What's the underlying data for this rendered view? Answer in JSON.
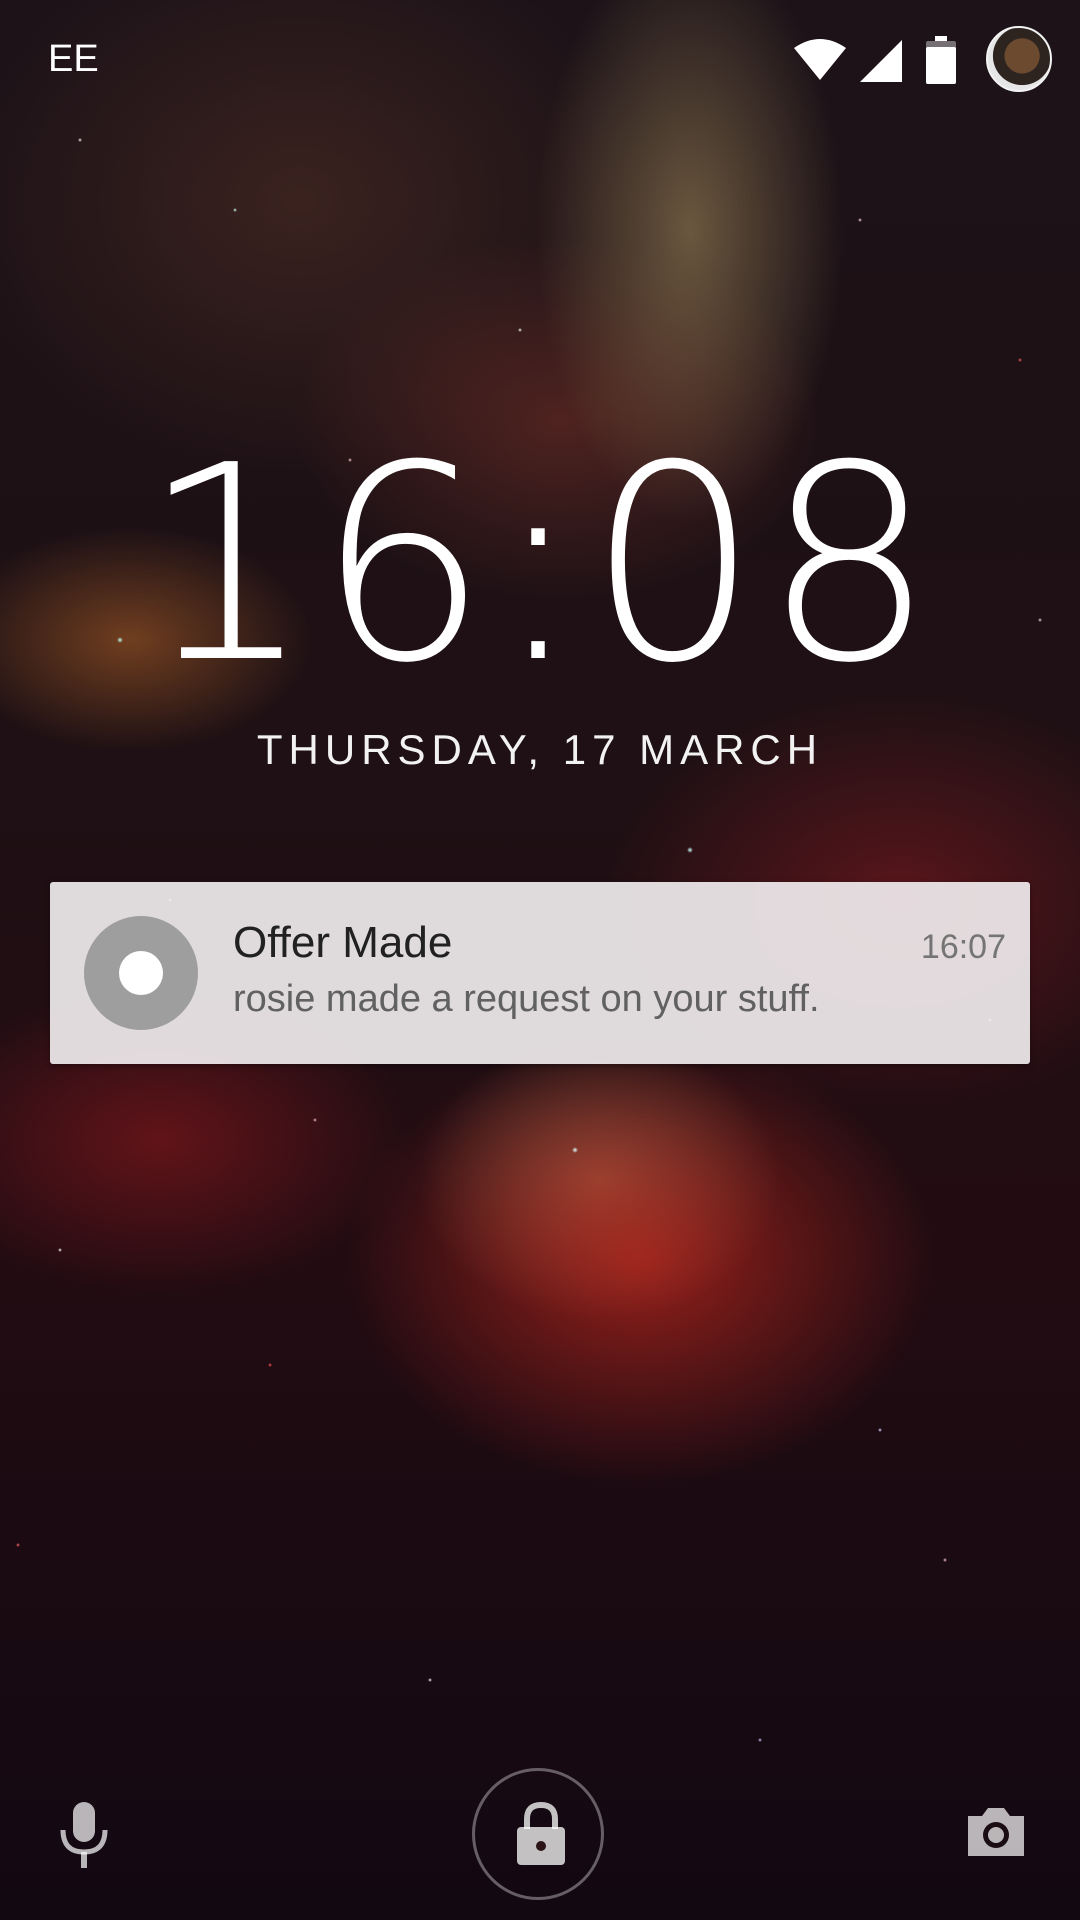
{
  "status_bar": {
    "carrier": "EE",
    "icons": [
      "wifi-icon",
      "signal-icon",
      "battery-icon",
      "avatar"
    ]
  },
  "lockscreen": {
    "time": "16:08",
    "date": "THURSDAY, 17 MARCH"
  },
  "notification": {
    "title": "Offer Made",
    "text": "rosie made a request on your stuff.",
    "time": "16:07",
    "icon": "app-circle-icon"
  },
  "bottom_bar": {
    "left": "mic-icon",
    "center": "lock-icon",
    "right": "camera-icon"
  },
  "colors": {
    "text": "#ffffff",
    "notification_bg": "#f0ecee",
    "notification_icon": "#9e9e9e"
  }
}
